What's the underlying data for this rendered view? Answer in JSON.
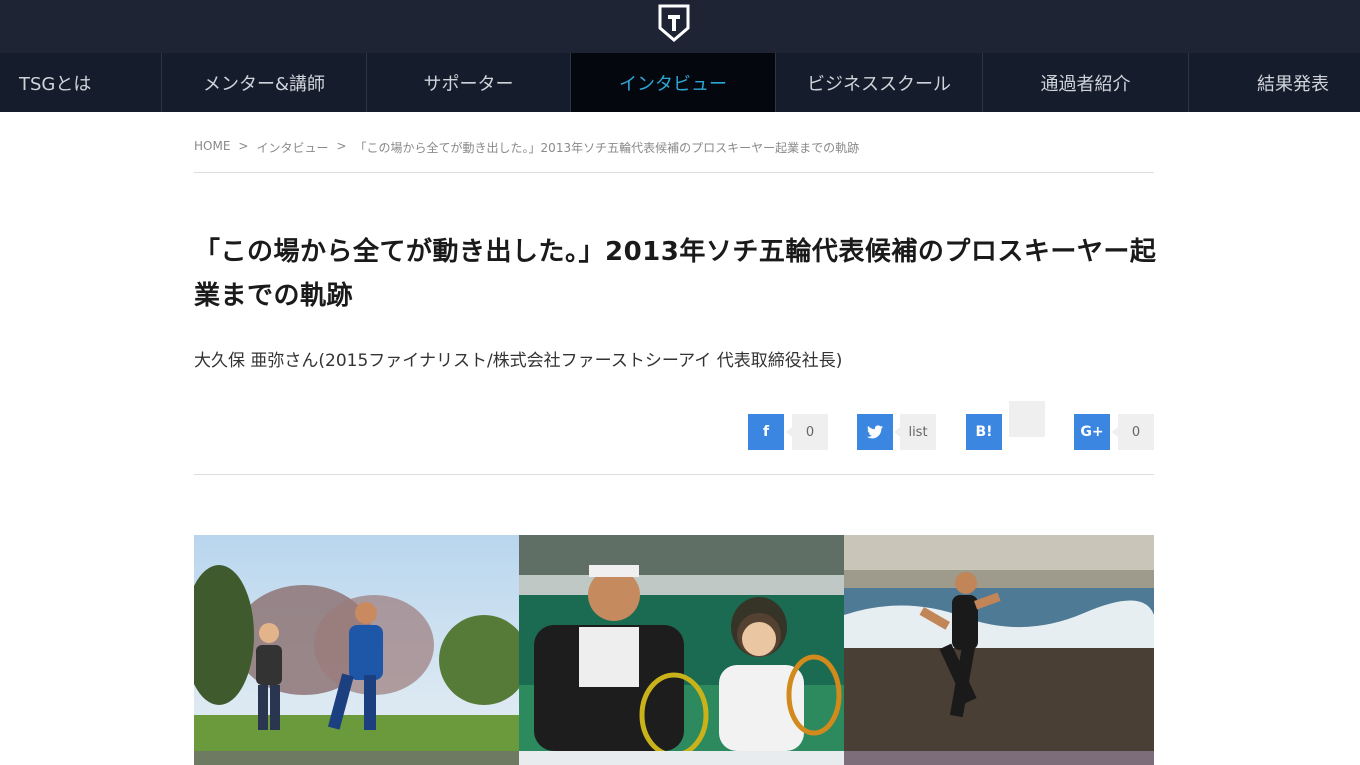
{
  "header": {
    "logo_letter": "T",
    "logo_icon": "shield-t-logo"
  },
  "nav": {
    "items": [
      {
        "label": "TSGとは"
      },
      {
        "label": "メンター&講師"
      },
      {
        "label": "サポーター"
      },
      {
        "label": "インタビュー",
        "active": true
      },
      {
        "label": "ビジネススクール"
      },
      {
        "label": "通過者紹介"
      },
      {
        "label": "結果発表"
      }
    ]
  },
  "breadcrumb": {
    "home": "HOME",
    "section": "インタビュー",
    "current": "「この場から全てが動き出した。」2013年ソチ五輪代表候補のプロスキーヤー起業までの軌跡",
    "separator": ">"
  },
  "article": {
    "title": "「この場から全てが動き出した。」2013年ソチ五輪代表候補のプロスキーヤー起業までの軌跡",
    "subtitle": "大久保 亜弥さん(2015ファイナリスト/株式会社ファーストシーアイ 代表取締役社長)"
  },
  "share": {
    "facebook": {
      "icon": "f",
      "count": "0"
    },
    "twitter": {
      "icon": "twitter-bird-icon",
      "count": "list"
    },
    "hatena": {
      "icon": "B!",
      "count": ""
    },
    "googleplus": {
      "icon": "G+",
      "count": "0"
    }
  },
  "colors": {
    "topbar": "#1e2434",
    "nav_bg": "#151c2b",
    "nav_active_bg": "#04070d",
    "nav_active_text": "#2ea7d6",
    "share_blue": "#3b86e0"
  }
}
